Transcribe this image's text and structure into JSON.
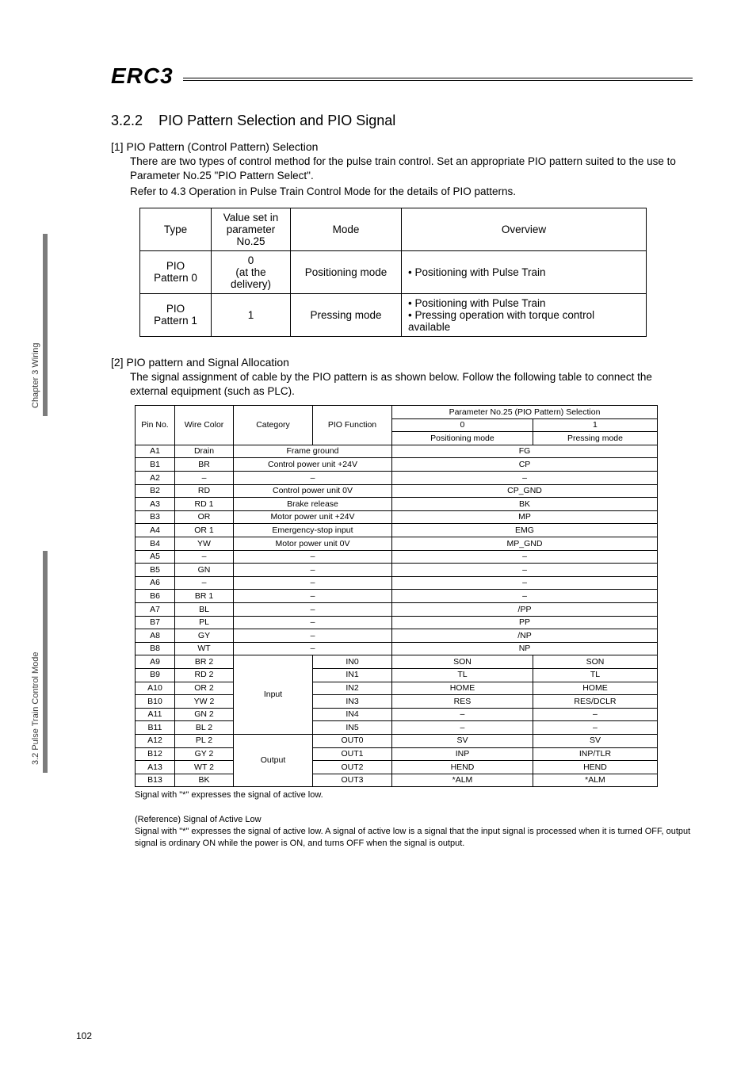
{
  "sidebar": {
    "tab1": "Chapter 3 Wiring",
    "tab2": "3.2 Pulse Train Control Mode"
  },
  "logo": "ERC3",
  "section_num": "3.2.2",
  "section_title": "PIO Pattern Selection and PIO Signal",
  "part1": {
    "heading": "[1]  PIO Pattern (Control Pattern) Selection",
    "p1": "There are two types of control method for the pulse train control. Set an appropriate PIO pattern suited to the use to Parameter No.25 \"PIO Pattern Select\".",
    "p2": "Refer to 4.3 Operation in Pulse Train Control Mode for the details of PIO patterns.",
    "table": {
      "headers": [
        "Type",
        "Value set in parameter No.25",
        "Mode",
        "Overview"
      ],
      "rows": [
        {
          "type": "PIO\nPattern 0",
          "value": "0\n(at the delivery)",
          "mode": "Positioning mode",
          "overview": "• Positioning with Pulse Train"
        },
        {
          "type": "PIO\nPattern 1",
          "value": "1",
          "mode": "Pressing mode",
          "overview": "• Positioning with Pulse Train\n• Pressing operation with torque control available"
        }
      ]
    }
  },
  "part2": {
    "heading": "[2]  PIO pattern and Signal Allocation",
    "p1": "The signal assignment of cable by the PIO pattern is as shown below. Follow the following table to connect the external equipment (such as PLC).",
    "table": {
      "header_top": "Parameter No.25 (PIO Pattern) Selection",
      "h_pin": "Pin No.",
      "h_wire": "Wire Color",
      "h_cat": "Category",
      "h_func": "PIO Function",
      "h_p0": "0",
      "h_p1": "1",
      "h_pos": "Positioning mode",
      "h_press": "Pressing mode",
      "rows": [
        {
          "pin": "A1",
          "wire": "Drain",
          "cat": "Frame ground",
          "func": "",
          "sig": "FG",
          "sig2": ""
        },
        {
          "pin": "B1",
          "wire": "BR",
          "cat": "Control power unit +24V",
          "func": "",
          "sig": "CP",
          "sig2": ""
        },
        {
          "pin": "A2",
          "wire": "–",
          "cat": "–",
          "func": "",
          "sig": "–",
          "sig2": ""
        },
        {
          "pin": "B2",
          "wire": "RD",
          "cat": "Control power unit 0V",
          "func": "",
          "sig": "CP_GND",
          "sig2": ""
        },
        {
          "pin": "A3",
          "wire": "RD 1",
          "cat": "Brake release",
          "func": "",
          "sig": "BK",
          "sig2": ""
        },
        {
          "pin": "B3",
          "wire": "OR",
          "cat": "Motor power unit +24V",
          "func": "",
          "sig": "MP",
          "sig2": ""
        },
        {
          "pin": "A4",
          "wire": "OR 1",
          "cat": "Emergency-stop input",
          "func": "",
          "sig": "EMG",
          "sig2": ""
        },
        {
          "pin": "B4",
          "wire": "YW",
          "cat": "Motor power unit 0V",
          "func": "",
          "sig": "MP_GND",
          "sig2": ""
        },
        {
          "pin": "A5",
          "wire": "–",
          "cat": "–",
          "func": "",
          "sig": "–",
          "sig2": ""
        },
        {
          "pin": "B5",
          "wire": "GN",
          "cat": "–",
          "func": "",
          "sig": "–",
          "sig2": ""
        },
        {
          "pin": "A6",
          "wire": "–",
          "cat": "–",
          "func": "",
          "sig": "–",
          "sig2": ""
        },
        {
          "pin": "B6",
          "wire": "BR 1",
          "cat": "–",
          "func": "",
          "sig": "–",
          "sig2": ""
        },
        {
          "pin": "A7",
          "wire": "BL",
          "cat": "–",
          "func": "",
          "sig": "/PP",
          "sig2": ""
        },
        {
          "pin": "B7",
          "wire": "PL",
          "cat": "–",
          "func": "",
          "sig": "PP",
          "sig2": ""
        },
        {
          "pin": "A8",
          "wire": "GY",
          "cat": "–",
          "func": "",
          "sig": "/NP",
          "sig2": ""
        },
        {
          "pin": "B8",
          "wire": "WT",
          "cat": "–",
          "func": "",
          "sig": "NP",
          "sig2": ""
        },
        {
          "pin": "A9",
          "wire": "BR 2",
          "cat": "Input",
          "func": "IN0",
          "sig": "SON",
          "sig2": "SON"
        },
        {
          "pin": "B9",
          "wire": "RD 2",
          "cat": "",
          "func": "IN1",
          "sig": "TL",
          "sig2": "TL"
        },
        {
          "pin": "A10",
          "wire": "OR 2",
          "cat": "",
          "func": "IN2",
          "sig": "HOME",
          "sig2": "HOME"
        },
        {
          "pin": "B10",
          "wire": "YW 2",
          "cat": "",
          "func": "IN3",
          "sig": "RES",
          "sig2": "RES/DCLR"
        },
        {
          "pin": "A11",
          "wire": "GN 2",
          "cat": "",
          "func": "IN4",
          "sig": "–",
          "sig2": "–"
        },
        {
          "pin": "B11",
          "wire": "BL 2",
          "cat": "",
          "func": "IN5",
          "sig": "–",
          "sig2": "–"
        },
        {
          "pin": "A12",
          "wire": "PL 2",
          "cat": "Output",
          "func": "OUT0",
          "sig": "SV",
          "sig2": "SV"
        },
        {
          "pin": "B12",
          "wire": "GY 2",
          "cat": "",
          "func": "OUT1",
          "sig": "INP",
          "sig2": "INP/TLR"
        },
        {
          "pin": "A13",
          "wire": "WT 2",
          "cat": "",
          "func": "OUT2",
          "sig": "HEND",
          "sig2": "HEND"
        },
        {
          "pin": "B13",
          "wire": "BK",
          "cat": "",
          "func": "OUT3",
          "sig": "*ALM",
          "sig2": "*ALM"
        }
      ]
    },
    "footnote": "Signal with \"*\" expresses the signal of active low.",
    "ref_title": "(Reference) Signal of Active Low",
    "ref_body": "Signal with \"*\" expresses the signal of active low. A signal of active low is a signal that the input signal is processed when it is turned OFF, output signal is ordinary ON while the power is ON, and turns OFF when the signal is output."
  },
  "page_number": "102"
}
